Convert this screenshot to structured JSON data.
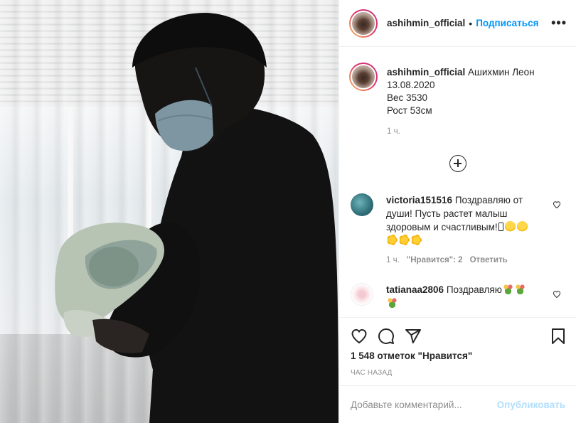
{
  "post": {
    "username": "ashihmin_official",
    "follow_label": "Подписаться",
    "separator": "•",
    "more_label": "•••",
    "caption": {
      "username": "ashihmin_official",
      "line1": "Ашихмин Леон",
      "line2": "13.08.2020",
      "line3": "Вес 3530",
      "line4": "Рост 53см",
      "time": "1 ч."
    },
    "comments": [
      {
        "username": "victoria151516",
        "text": "Поздравляю от души! Пусть растет малыш здоровым и счастливым!",
        "time": "1 ч.",
        "likes": "\"Нравится\": 2",
        "reply_label": "Ответить"
      },
      {
        "username": "tatianaa2806",
        "text": "Поздравляю"
      }
    ],
    "likes_text": "1 548 отметок \"Нравится\"",
    "posted_ago": "ЧАС НАЗАД",
    "comment_placeholder": "Добавьте комментарий...",
    "post_button": "Опубликовать"
  },
  "icons": [
    "more-icon",
    "load-more-icon",
    "heart-icon",
    "comment-icon",
    "share-icon",
    "bookmark-icon"
  ],
  "colors": {
    "link_blue": "#0095f6",
    "post_disabled": "#b2dffc",
    "muted": "#8e8e8e"
  }
}
